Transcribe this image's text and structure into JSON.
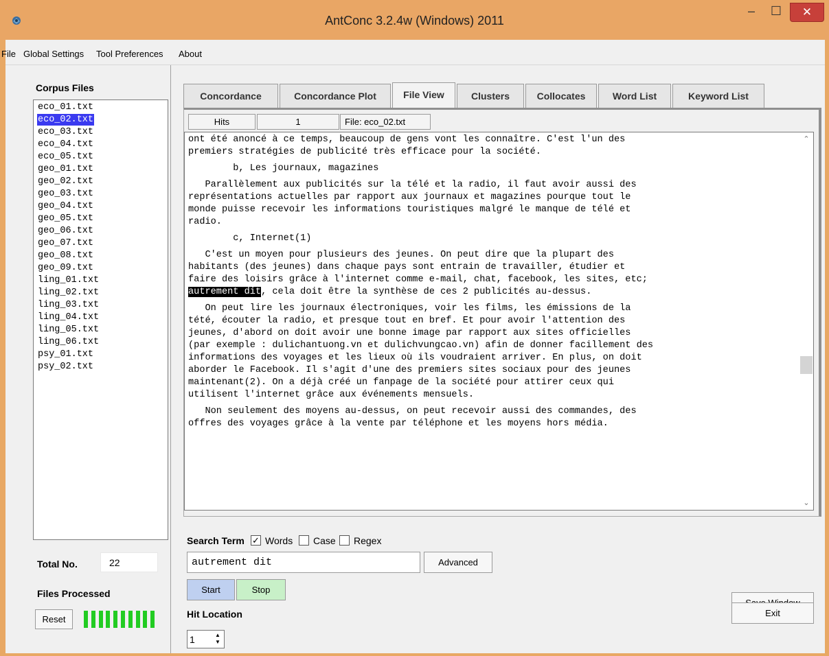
{
  "window": {
    "title": "AntConc 3.2.4w (Windows) 2011",
    "minimize_glyph": "–",
    "maximize_glyph": "☐",
    "close_glyph": "✕"
  },
  "menu": [
    "File",
    "Global Settings",
    "Tool Preferences",
    "About"
  ],
  "left": {
    "corpus_label": "Corpus Files",
    "files": [
      "eco_01.txt",
      "eco_02.txt",
      "eco_03.txt",
      "eco_04.txt",
      "eco_05.txt",
      "geo_01.txt",
      "geo_02.txt",
      "geo_03.txt",
      "geo_04.txt",
      "geo_05.txt",
      "geo_06.txt",
      "geo_07.txt",
      "geo_08.txt",
      "geo_09.txt",
      "ling_01.txt",
      "ling_02.txt",
      "ling_03.txt",
      "ling_04.txt",
      "ling_05.txt",
      "ling_06.txt",
      "psy_01.txt",
      "psy_02.txt"
    ],
    "selected_file": "eco_02.txt",
    "total_label": "Total No.",
    "total_value": "22",
    "processed_label": "Files Processed",
    "reset_label": "Reset",
    "progress_fraction": 1.0
  },
  "tabs": [
    "Concordance",
    "Concordance Plot",
    "File View",
    "Clusters",
    "Collocates",
    "Word List",
    "Keyword List"
  ],
  "active_tab": "File View",
  "file_view": {
    "hits_label": "Hits",
    "hits_value": "1",
    "file_label": "File: eco_02.txt",
    "highlight": "autrement dit",
    "lines": [
      "ont été anoncé à ce temps, beaucoup de gens vont les connaître. C'est l'un des",
      "premiers stratégies de publicité très efficace pour la société.",
      "        b, Les journaux, magazines",
      "   Parallèlement aux publicités sur la télé et la radio, il faut avoir aussi des",
      "représentations actuelles par rapport aux journaux et magazines pourque tout le",
      "monde puisse recevoir les informations touristiques malgré le manque de télé et",
      "radio.",
      "        c, Internet(1)",
      "   C'est un moyen pour plusieurs des jeunes. On peut dire que la plupart des",
      "habitants (des jeunes) dans chaque pays sont entrain de travailler, étudier et",
      "faire des loisirs grâce à l'internet comme e-mail, chat, facebook, les sites, etc;",
      "autrement dit, cela doit être la synthèse de ces 2 publicités au-dessus.",
      "   On peut lire les journaux électroniques, voir les films, les émissions de la",
      "tété, écouter la radio, et presque tout en bref. Et pour avoir l'attention des",
      "jeunes, d'abord on doit avoir une bonne image par rapport aux sites officielles",
      "(par exemple : dulichantuong.vn et dulichvungcao.vn) afin de donner facillement des",
      "informations des voyages et les lieux où ils voudraient arriver. En plus, on doit",
      "aborder le Facebook. Il s'agit d'une des premiers sites sociaux pour des jeunes",
      "maintenant(2). On a déjà créé un fanpage de la société pour attirer ceux qui",
      "utilisent l'internet grâce aux événements mensuels.",
      "   Non seulement des moyens au-dessus, on peut recevoir aussi des commandes, des",
      "offres des voyages grâce à la vente par téléphone et les moyens hors média."
    ],
    "scroll_up_glyph": "⌃",
    "scroll_down_glyph": "⌄"
  },
  "search": {
    "label": "Search Term",
    "words_label": "Words",
    "words_checked": true,
    "case_label": "Case",
    "case_checked": false,
    "regex_label": "Regex",
    "regex_checked": false,
    "value": "autrement dit",
    "advanced_label": "Advanced",
    "start_label": "Start",
    "stop_label": "Stop",
    "hit_location_label": "Hit Location",
    "hit_location_value": "1",
    "check_glyph": "✓"
  },
  "footer": {
    "save_label": "Save Window",
    "exit_label": "Exit"
  },
  "colors": {
    "titlebar": "#e9a665",
    "selection": "#3a3af0",
    "progress": "#22cc22",
    "close_button": "#c7403a",
    "start_button": "#bfd0f0",
    "stop_button": "#c8f0c8"
  }
}
